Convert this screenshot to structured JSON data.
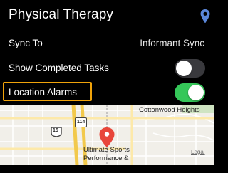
{
  "header": {
    "title": "Physical Therapy",
    "pin_icon": "map-pin-icon",
    "accent_color": "#5b87d9"
  },
  "settings": {
    "sync_to": {
      "label": "Sync To",
      "value": "Informant Sync"
    },
    "show_completed": {
      "label": "Show Completed Tasks",
      "enabled": false
    },
    "location_alarms": {
      "label": "Location Alarms",
      "enabled": true,
      "highlight_color": "#f0a30a"
    }
  },
  "map": {
    "place_label_line1": "Ultimate Sports",
    "place_label_line2": "Performance &",
    "area_label": "Cottonwood Heights",
    "legal_label": "Legal",
    "interstate_number": "15",
    "highway_number": "114",
    "pin_color": "#e8463a"
  }
}
